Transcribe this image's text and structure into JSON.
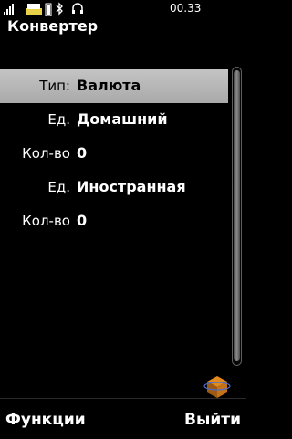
{
  "status_bar": {
    "time": "00.33",
    "icons": [
      "signal-icon",
      "tray-icon",
      "battery-icon",
      "bluetooth-icon",
      "headset-icon"
    ]
  },
  "app": {
    "title": "Конвертер"
  },
  "fields": [
    {
      "label": "Тип:",
      "value": "Валюта"
    },
    {
      "label": "Ед.",
      "value": "Домашний"
    },
    {
      "label": "Кол-во",
      "value": "0"
    },
    {
      "label": "Ед.",
      "value": "Иностранная"
    },
    {
      "label": "Кол-во",
      "value": "0"
    }
  ],
  "softkeys": {
    "left": "Функции",
    "right": "Выйти"
  },
  "colors": {
    "selection_light": "#c4c4c4",
    "selection_dark": "#a9a9a9",
    "background": "#000000"
  }
}
